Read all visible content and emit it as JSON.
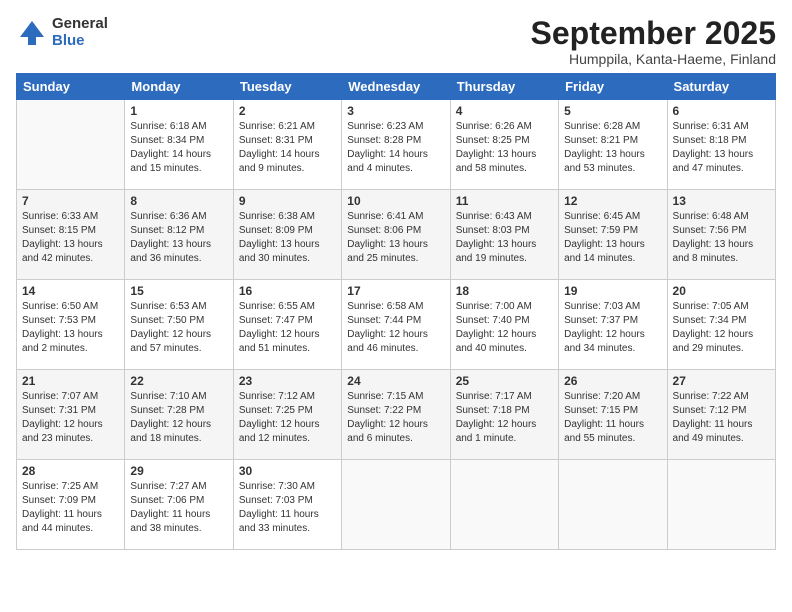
{
  "logo": {
    "general": "General",
    "blue": "Blue"
  },
  "title": "September 2025",
  "subtitle": "Humppila, Kanta-Haeme, Finland",
  "headers": [
    "Sunday",
    "Monday",
    "Tuesday",
    "Wednesday",
    "Thursday",
    "Friday",
    "Saturday"
  ],
  "weeks": [
    [
      {
        "num": "",
        "detail": ""
      },
      {
        "num": "1",
        "detail": "Sunrise: 6:18 AM\nSunset: 8:34 PM\nDaylight: 14 hours\nand 15 minutes."
      },
      {
        "num": "2",
        "detail": "Sunrise: 6:21 AM\nSunset: 8:31 PM\nDaylight: 14 hours\nand 9 minutes."
      },
      {
        "num": "3",
        "detail": "Sunrise: 6:23 AM\nSunset: 8:28 PM\nDaylight: 14 hours\nand 4 minutes."
      },
      {
        "num": "4",
        "detail": "Sunrise: 6:26 AM\nSunset: 8:25 PM\nDaylight: 13 hours\nand 58 minutes."
      },
      {
        "num": "5",
        "detail": "Sunrise: 6:28 AM\nSunset: 8:21 PM\nDaylight: 13 hours\nand 53 minutes."
      },
      {
        "num": "6",
        "detail": "Sunrise: 6:31 AM\nSunset: 8:18 PM\nDaylight: 13 hours\nand 47 minutes."
      }
    ],
    [
      {
        "num": "7",
        "detail": "Sunrise: 6:33 AM\nSunset: 8:15 PM\nDaylight: 13 hours\nand 42 minutes."
      },
      {
        "num": "8",
        "detail": "Sunrise: 6:36 AM\nSunset: 8:12 PM\nDaylight: 13 hours\nand 36 minutes."
      },
      {
        "num": "9",
        "detail": "Sunrise: 6:38 AM\nSunset: 8:09 PM\nDaylight: 13 hours\nand 30 minutes."
      },
      {
        "num": "10",
        "detail": "Sunrise: 6:41 AM\nSunset: 8:06 PM\nDaylight: 13 hours\nand 25 minutes."
      },
      {
        "num": "11",
        "detail": "Sunrise: 6:43 AM\nSunset: 8:03 PM\nDaylight: 13 hours\nand 19 minutes."
      },
      {
        "num": "12",
        "detail": "Sunrise: 6:45 AM\nSunset: 7:59 PM\nDaylight: 13 hours\nand 14 minutes."
      },
      {
        "num": "13",
        "detail": "Sunrise: 6:48 AM\nSunset: 7:56 PM\nDaylight: 13 hours\nand 8 minutes."
      }
    ],
    [
      {
        "num": "14",
        "detail": "Sunrise: 6:50 AM\nSunset: 7:53 PM\nDaylight: 13 hours\nand 2 minutes."
      },
      {
        "num": "15",
        "detail": "Sunrise: 6:53 AM\nSunset: 7:50 PM\nDaylight: 12 hours\nand 57 minutes."
      },
      {
        "num": "16",
        "detail": "Sunrise: 6:55 AM\nSunset: 7:47 PM\nDaylight: 12 hours\nand 51 minutes."
      },
      {
        "num": "17",
        "detail": "Sunrise: 6:58 AM\nSunset: 7:44 PM\nDaylight: 12 hours\nand 46 minutes."
      },
      {
        "num": "18",
        "detail": "Sunrise: 7:00 AM\nSunset: 7:40 PM\nDaylight: 12 hours\nand 40 minutes."
      },
      {
        "num": "19",
        "detail": "Sunrise: 7:03 AM\nSunset: 7:37 PM\nDaylight: 12 hours\nand 34 minutes."
      },
      {
        "num": "20",
        "detail": "Sunrise: 7:05 AM\nSunset: 7:34 PM\nDaylight: 12 hours\nand 29 minutes."
      }
    ],
    [
      {
        "num": "21",
        "detail": "Sunrise: 7:07 AM\nSunset: 7:31 PM\nDaylight: 12 hours\nand 23 minutes."
      },
      {
        "num": "22",
        "detail": "Sunrise: 7:10 AM\nSunset: 7:28 PM\nDaylight: 12 hours\nand 18 minutes."
      },
      {
        "num": "23",
        "detail": "Sunrise: 7:12 AM\nSunset: 7:25 PM\nDaylight: 12 hours\nand 12 minutes."
      },
      {
        "num": "24",
        "detail": "Sunrise: 7:15 AM\nSunset: 7:22 PM\nDaylight: 12 hours\nand 6 minutes."
      },
      {
        "num": "25",
        "detail": "Sunrise: 7:17 AM\nSunset: 7:18 PM\nDaylight: 12 hours\nand 1 minute."
      },
      {
        "num": "26",
        "detail": "Sunrise: 7:20 AM\nSunset: 7:15 PM\nDaylight: 11 hours\nand 55 minutes."
      },
      {
        "num": "27",
        "detail": "Sunrise: 7:22 AM\nSunset: 7:12 PM\nDaylight: 11 hours\nand 49 minutes."
      }
    ],
    [
      {
        "num": "28",
        "detail": "Sunrise: 7:25 AM\nSunset: 7:09 PM\nDaylight: 11 hours\nand 44 minutes."
      },
      {
        "num": "29",
        "detail": "Sunrise: 7:27 AM\nSunset: 7:06 PM\nDaylight: 11 hours\nand 38 minutes."
      },
      {
        "num": "30",
        "detail": "Sunrise: 7:30 AM\nSunset: 7:03 PM\nDaylight: 11 hours\nand 33 minutes."
      },
      {
        "num": "",
        "detail": ""
      },
      {
        "num": "",
        "detail": ""
      },
      {
        "num": "",
        "detail": ""
      },
      {
        "num": "",
        "detail": ""
      }
    ]
  ]
}
